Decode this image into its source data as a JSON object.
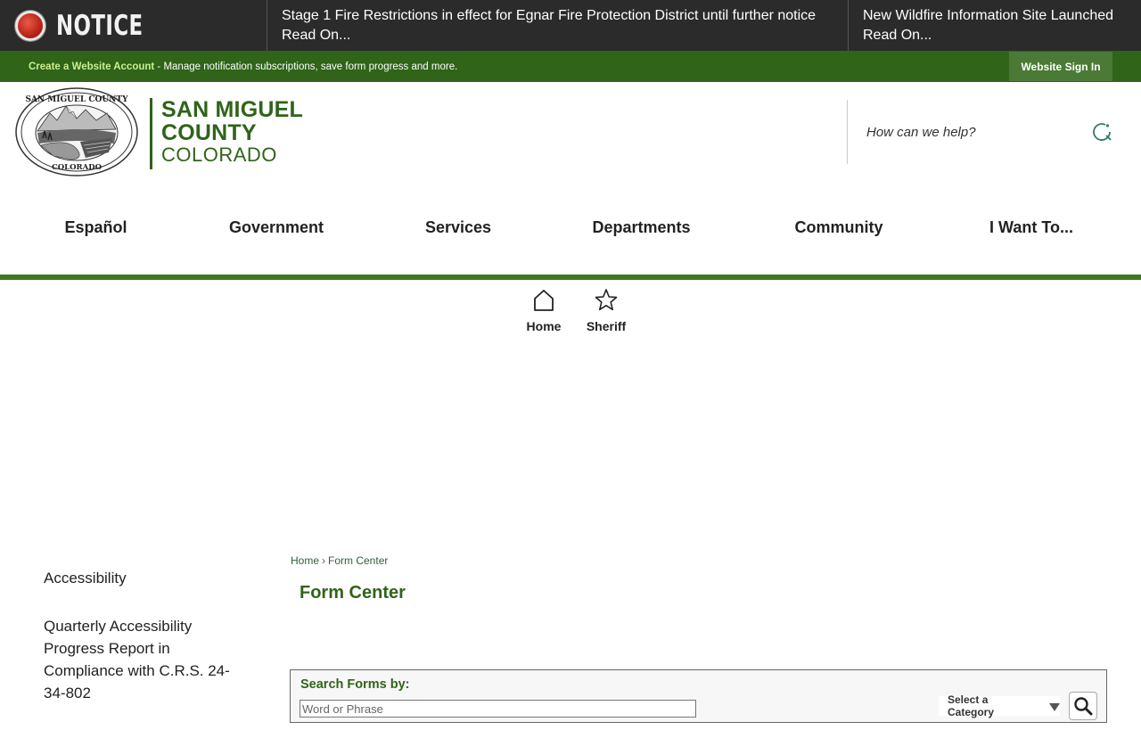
{
  "notice": {
    "label": "NOTICE",
    "items": [
      {
        "title": "Stage 1 Fire Restrictions in effect for Egnar Fire Protection District until further notice",
        "read_more": "Read On..."
      },
      {
        "title": "New Wildfire Information Site Launched",
        "read_more": "Read On..."
      }
    ]
  },
  "account_bar": {
    "link": "Create a Website Account",
    "message": " - Manage notification subscriptions, save form progress and more.",
    "sign_in": "Website Sign In"
  },
  "header": {
    "seal_icon": "county-seal-icon",
    "brand_line1": "SAN MIGUEL",
    "brand_line2": "COUNTY",
    "brand_line3": "COLORADO",
    "search_placeholder": "How can we help?"
  },
  "nav": {
    "items": [
      "Español",
      "Government",
      "Services",
      "Departments",
      "Community",
      "I Want To..."
    ]
  },
  "quick_links": [
    {
      "label": "Home",
      "icon": "home-icon"
    },
    {
      "label": "Sheriff",
      "icon": "star-icon"
    }
  ],
  "sidebar": {
    "items": [
      "Accessibility",
      "Quarterly Accessibility Progress Report in Compliance with C.R.S. 24-34-802"
    ]
  },
  "breadcrumb": {
    "home": "Home",
    "current": "Form Center"
  },
  "page_title": "Form Center",
  "search_forms": {
    "label": "Search Forms by:",
    "placeholder": "Word or Phrase",
    "category": "Select a Category"
  },
  "colors": {
    "brand_green": "#2f6419",
    "nav_line": "#3d7a1e",
    "notice_bg": "#2b2b2b"
  }
}
